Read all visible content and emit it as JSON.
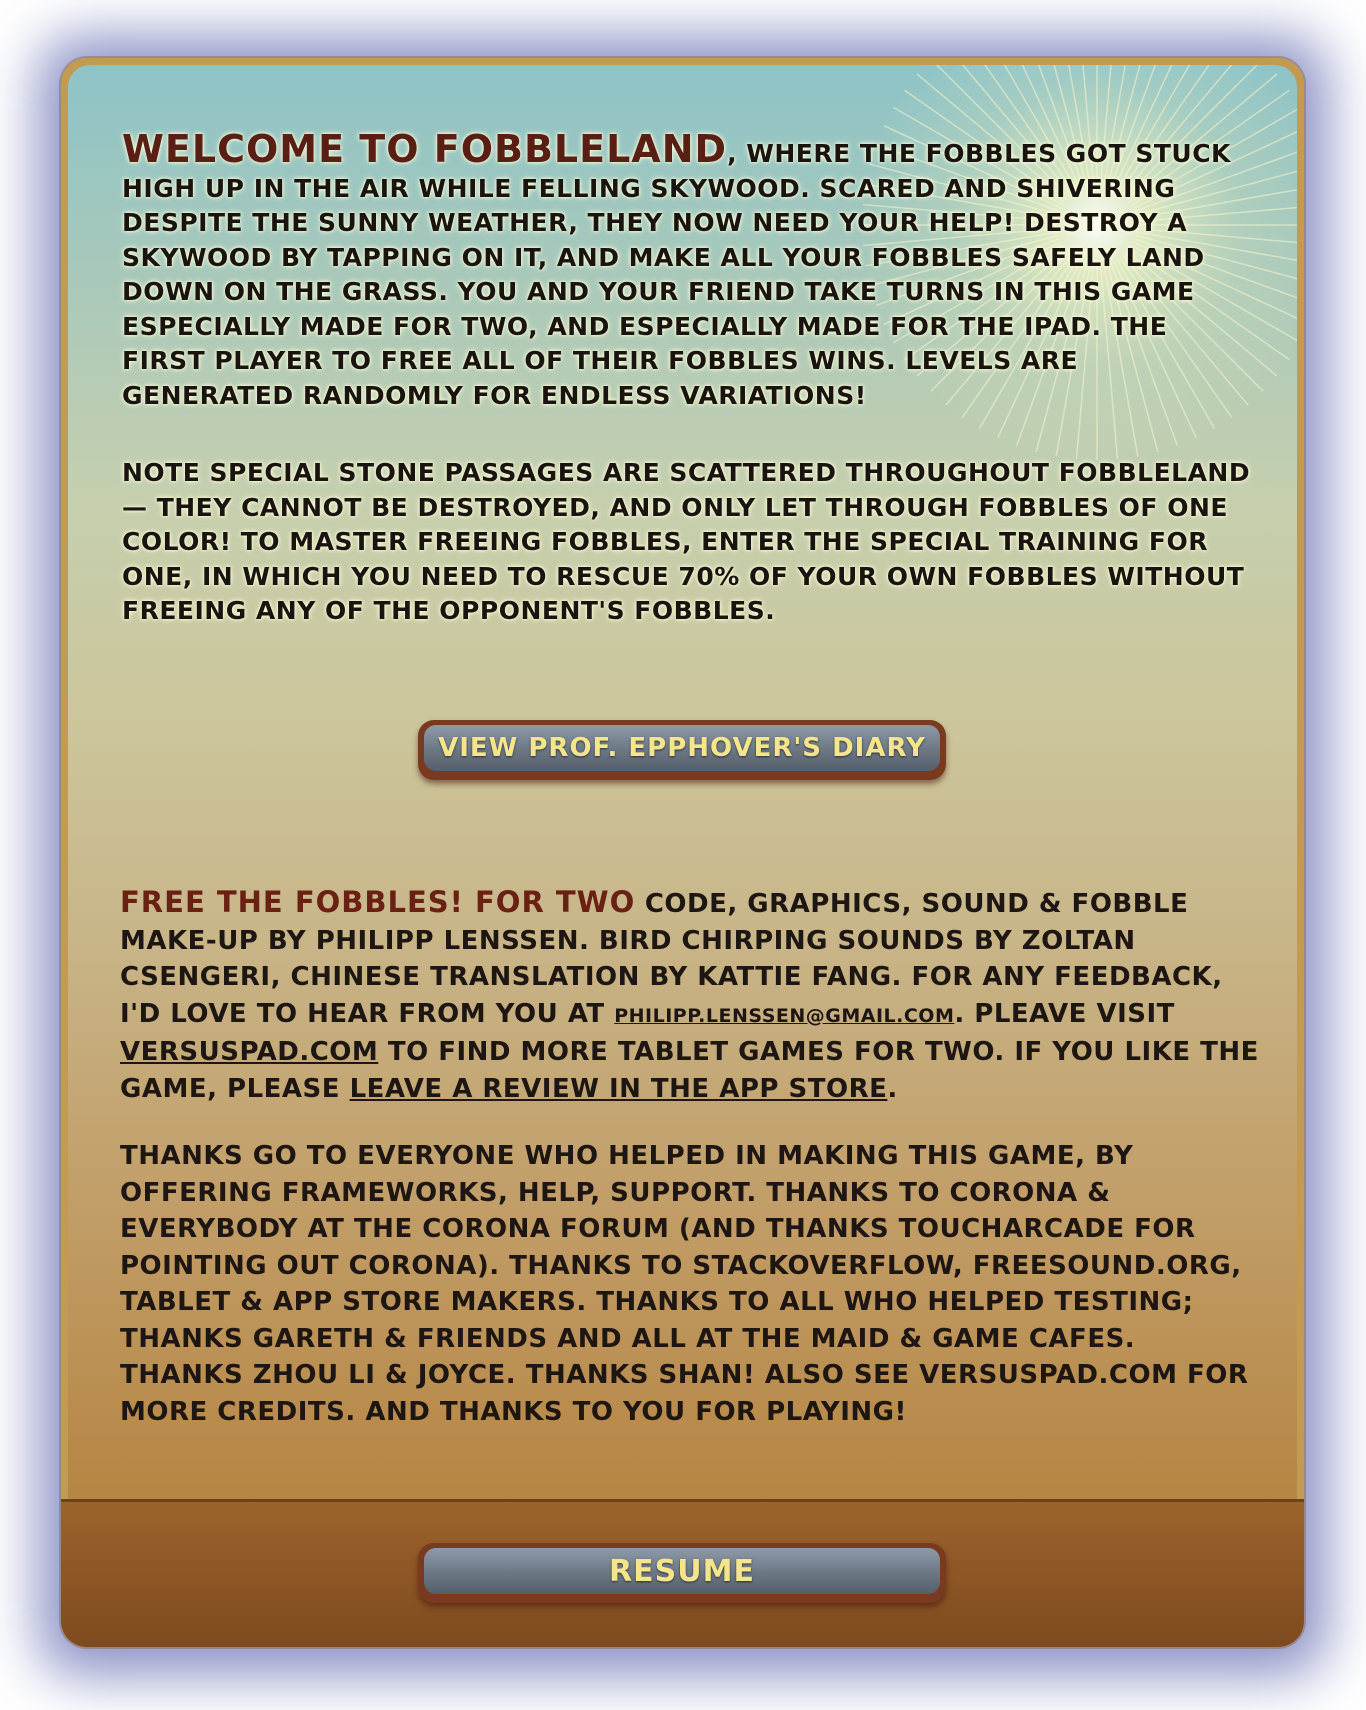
{
  "intro": {
    "headline": "Welcome to Fobbleland",
    "body": ", where the Fobbles got stuck high up in the air while felling skywood. Scared and shivering despite the sunny weather, they now need your help! Destroy a skywood by tapping on it, and make all your Fobbles safely land down on the grass. You and your friend take turns in this game especially made for two, and especially made for the iPad. The first player to free all of their Fobbles wins. Levels are generated randomly for endless variations!"
  },
  "note": {
    "body": "Note special stone passages are scattered throughout Fobbleland — they cannot be destroyed, and only let through Fobbles of one color! To master freeing Fobbles, enter the special Training for One, in which you need to rescue 70% of your own Fobbles without freeing any of the opponent's Fobbles."
  },
  "buttons": {
    "diary": "View Prof. Epphover's Diary",
    "resume": "Resume"
  },
  "credits": {
    "game_title": "Free the Fobbles! for Two",
    "text_1": "  Code, graphics, sound & Fobble make-up by Philipp Lenssen. Bird chirping sounds by Zoltan Csengeri, Chinese translation by Kattie Fang. For any feedback, I'd love to hear from you at ",
    "email": "philipp.lenssen@gmail.com",
    "text_2": ". Pleave visit ",
    "site_link": "versuspad.com",
    "text_3": " to find more tablet games for two. If you like the game, please ",
    "review_link": "leave a review in the App Store",
    "text_4": "."
  },
  "thanks": {
    "body": "Thanks go to everyone who helped in making this game, by offering frameworks, help, support. Thanks to Corona & everybody at the Corona forum (and thanks Toucharcade for pointing out Corona). Thanks to Stackoverflow, freesound.org, tablet & app store makers. Thanks to all who helped testing; thanks Gareth & friends and all at the Maid & Game Cafes. Thanks Zhou Li & Joyce. Thanks Shan! Also see versuspad.com for more credits. And thanks to you for playing!"
  },
  "colors": {
    "headline": "#5a1f14",
    "button_text": "#f4e58a",
    "panel_border": "#c39a52",
    "footer": "#8a5424"
  }
}
